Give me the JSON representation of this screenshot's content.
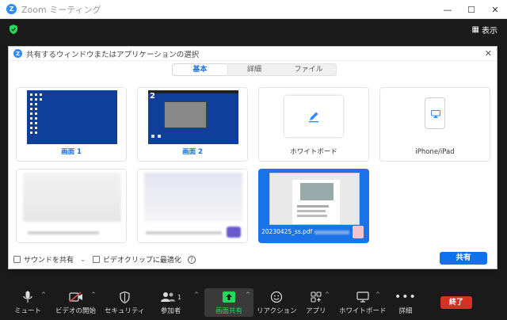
{
  "window": {
    "title": "Zoom ミーティング",
    "minimize": "—",
    "maximize": "☐",
    "close": "✕",
    "view_label": "表示"
  },
  "dialog": {
    "title": "共有するウィンドウまたはアプリケーションの選択",
    "close": "✕",
    "tabs": [
      {
        "label": "基本",
        "active": true
      },
      {
        "label": "詳細",
        "active": false
      },
      {
        "label": "ファイル",
        "active": false
      }
    ],
    "tiles": [
      {
        "label": "画面 1"
      },
      {
        "label": "画面 2"
      },
      {
        "label": "ホワイトボード"
      },
      {
        "label": "iPhone/iPad"
      },
      {
        "label": ""
      },
      {
        "label": ""
      },
      {
        "label": "20230425_ss.pdf -"
      }
    ],
    "screen2_number": "2",
    "share_sound": "サウンドを共有",
    "share_sound_caret": "⌄",
    "optimize_video": "ビデオクリップに最適化",
    "help": "?",
    "share_button": "共有"
  },
  "toolbar": {
    "items": [
      {
        "label": "ミュート"
      },
      {
        "label": "ビデオの開始"
      },
      {
        "label": "セキュリティ"
      },
      {
        "label": "参加者"
      },
      {
        "label": "画面共有"
      },
      {
        "label": "リアクション"
      },
      {
        "label": "アプリ"
      },
      {
        "label": "ホワイトボード"
      },
      {
        "label": "詳細"
      }
    ],
    "participants_count": "1",
    "end_label": "終了"
  },
  "colors": {
    "accent": "#0e72ed",
    "zoom_blue": "#2d8cff",
    "end_red": "#d93025",
    "selected_tile": "#1a73e8",
    "share_green": "#23d959"
  }
}
